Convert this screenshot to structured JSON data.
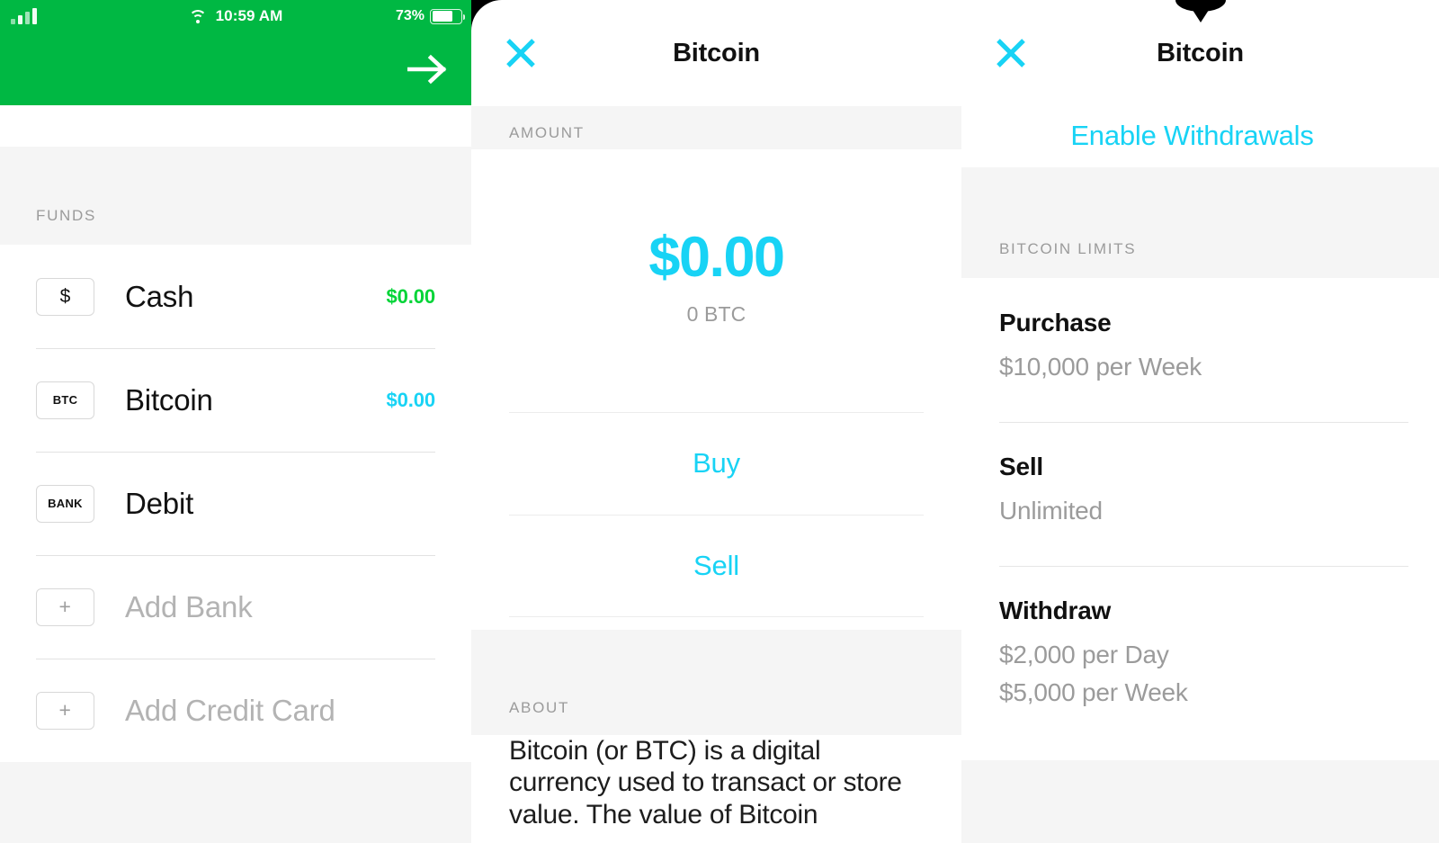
{
  "status_bar": {
    "time": "10:59 AM",
    "battery_percent": "73%",
    "wifi_icon": "wifi-icon",
    "signal_icon": "cellular-signal-icon",
    "battery_icon": "battery-icon"
  },
  "left_panel": {
    "header": {
      "forward_icon": "arrow-right-icon",
      "accent_color": "#00b843"
    },
    "section_label": "FUNDS",
    "rows": [
      {
        "chip": "$",
        "chip_style": "dollar",
        "name": "Cash",
        "amount": "$0.00",
        "amount_color": "#00d437",
        "muted": false
      },
      {
        "chip": "BTC",
        "chip_style": "small",
        "name": "Bitcoin",
        "amount": "$0.00",
        "amount_color": "#18d3f5",
        "muted": false
      },
      {
        "chip": "BANK",
        "chip_style": "small",
        "name": "Debit",
        "amount": "",
        "amount_color": "",
        "muted": false
      },
      {
        "chip": "+",
        "chip_style": "plus",
        "name": "Add Bank",
        "amount": "",
        "amount_color": "",
        "muted": true
      },
      {
        "chip": "+",
        "chip_style": "plus",
        "name": "Add Credit Card",
        "amount": "",
        "amount_color": "",
        "muted": true
      }
    ]
  },
  "middle_panel": {
    "title": "Bitcoin",
    "close_icon": "close-x-icon",
    "amount_section_label": "AMOUNT",
    "amount_primary": "$0.00",
    "amount_secondary": "0 BTC",
    "actions": [
      {
        "label": "Buy"
      },
      {
        "label": "Sell"
      }
    ],
    "about_section_label": "ABOUT",
    "about_text": "Bitcoin (or BTC) is a digital currency used to transact or store value. The value of Bitcoin"
  },
  "right_panel": {
    "title": "Bitcoin",
    "close_icon": "close-x-icon",
    "enable_withdrawals_label": "Enable Withdrawals",
    "limits_section_label": "BITCOIN LIMITS",
    "limits": [
      {
        "title": "Purchase",
        "values": [
          "$10,000 per Week"
        ]
      },
      {
        "title": "Sell",
        "values": [
          "Unlimited"
        ]
      },
      {
        "title": "Withdraw",
        "values": [
          "$2,000 per Day",
          "$5,000 per Week"
        ]
      }
    ]
  },
  "colors": {
    "brand_green": "#00b843",
    "cash_green": "#00d437",
    "accent_cyan": "#18d3f5",
    "section_gray": "#f5f5f5",
    "muted_text": "#9b9b9b"
  }
}
